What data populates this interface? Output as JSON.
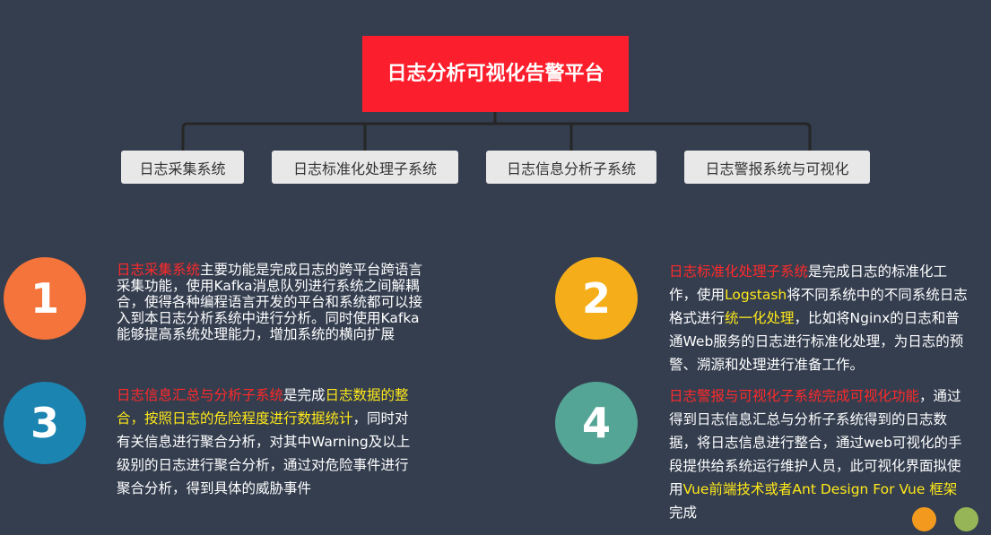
{
  "root": {
    "title": "日志分析可视化告警平台"
  },
  "children": [
    {
      "label": "日志采集系统"
    },
    {
      "label": "日志标准化处理子系统"
    },
    {
      "label": "日志信息分析子系统"
    },
    {
      "label": "日志警报系统与可视化"
    }
  ],
  "colors": {
    "background": "#343e4f",
    "root": "#fb1f2d",
    "node": "#e8e8e8",
    "connector": "#262626",
    "circle1": "#f4743b",
    "circle2": "#f5ae1a",
    "circle3": "#1b84b0",
    "circle4": "#55a596",
    "dot_orange": "#f39a1e",
    "dot_green": "#95b556"
  },
  "items": [
    {
      "number": "1",
      "highlight": "日志采集系统",
      "text": "主要功能是完成日志的跨平台跨语言采集功能，使用Kafka消息队列进行系统之间解耦合，使得各种编程语言开发的平台和系统都可以接入到本日志分析系统中进行分析。同时使用Kafka能够提高系统处理能力，增加系统的横向扩展"
    },
    {
      "number": "2",
      "highlight": "日志标准化处理子系统",
      "text_a": "是完成日志的标准化工作，使用",
      "yellow_a": "Logstash",
      "text_b": "将不同系统中的不同系统日志格式进行",
      "yellow_b": "统一化处理",
      "text_c": "，比如将Nginx的日志和普通Web服务的日志进行标准化处理，为日志的预警、溯源和处理进行准备工作。"
    },
    {
      "number": "3",
      "highlight": "日志信息汇总与分析子系统",
      "text_a": "是完成",
      "yellow_a": "日志数据的整合，按照日志的危险程度进行数据统计",
      "text_b": "，同时对有关信息进行聚合分析，对其中Warning及以上级别的日志进行聚合分析，通过对危险事件进行聚合分析，得到具体的威胁事件"
    },
    {
      "number": "4",
      "highlight": "日志警报与可视化子系统完成可视化功能",
      "text_a": "，通过得到日志信息汇总与分析子系统得到的日志数据，将日志信息进行整合，通过web可视化的手段提供给系统运行维护人员，此可视化界面拟使用",
      "yellow_a": "Vue前端技术或者Ant Design For Vue 框架",
      "text_b": "完成"
    }
  ]
}
